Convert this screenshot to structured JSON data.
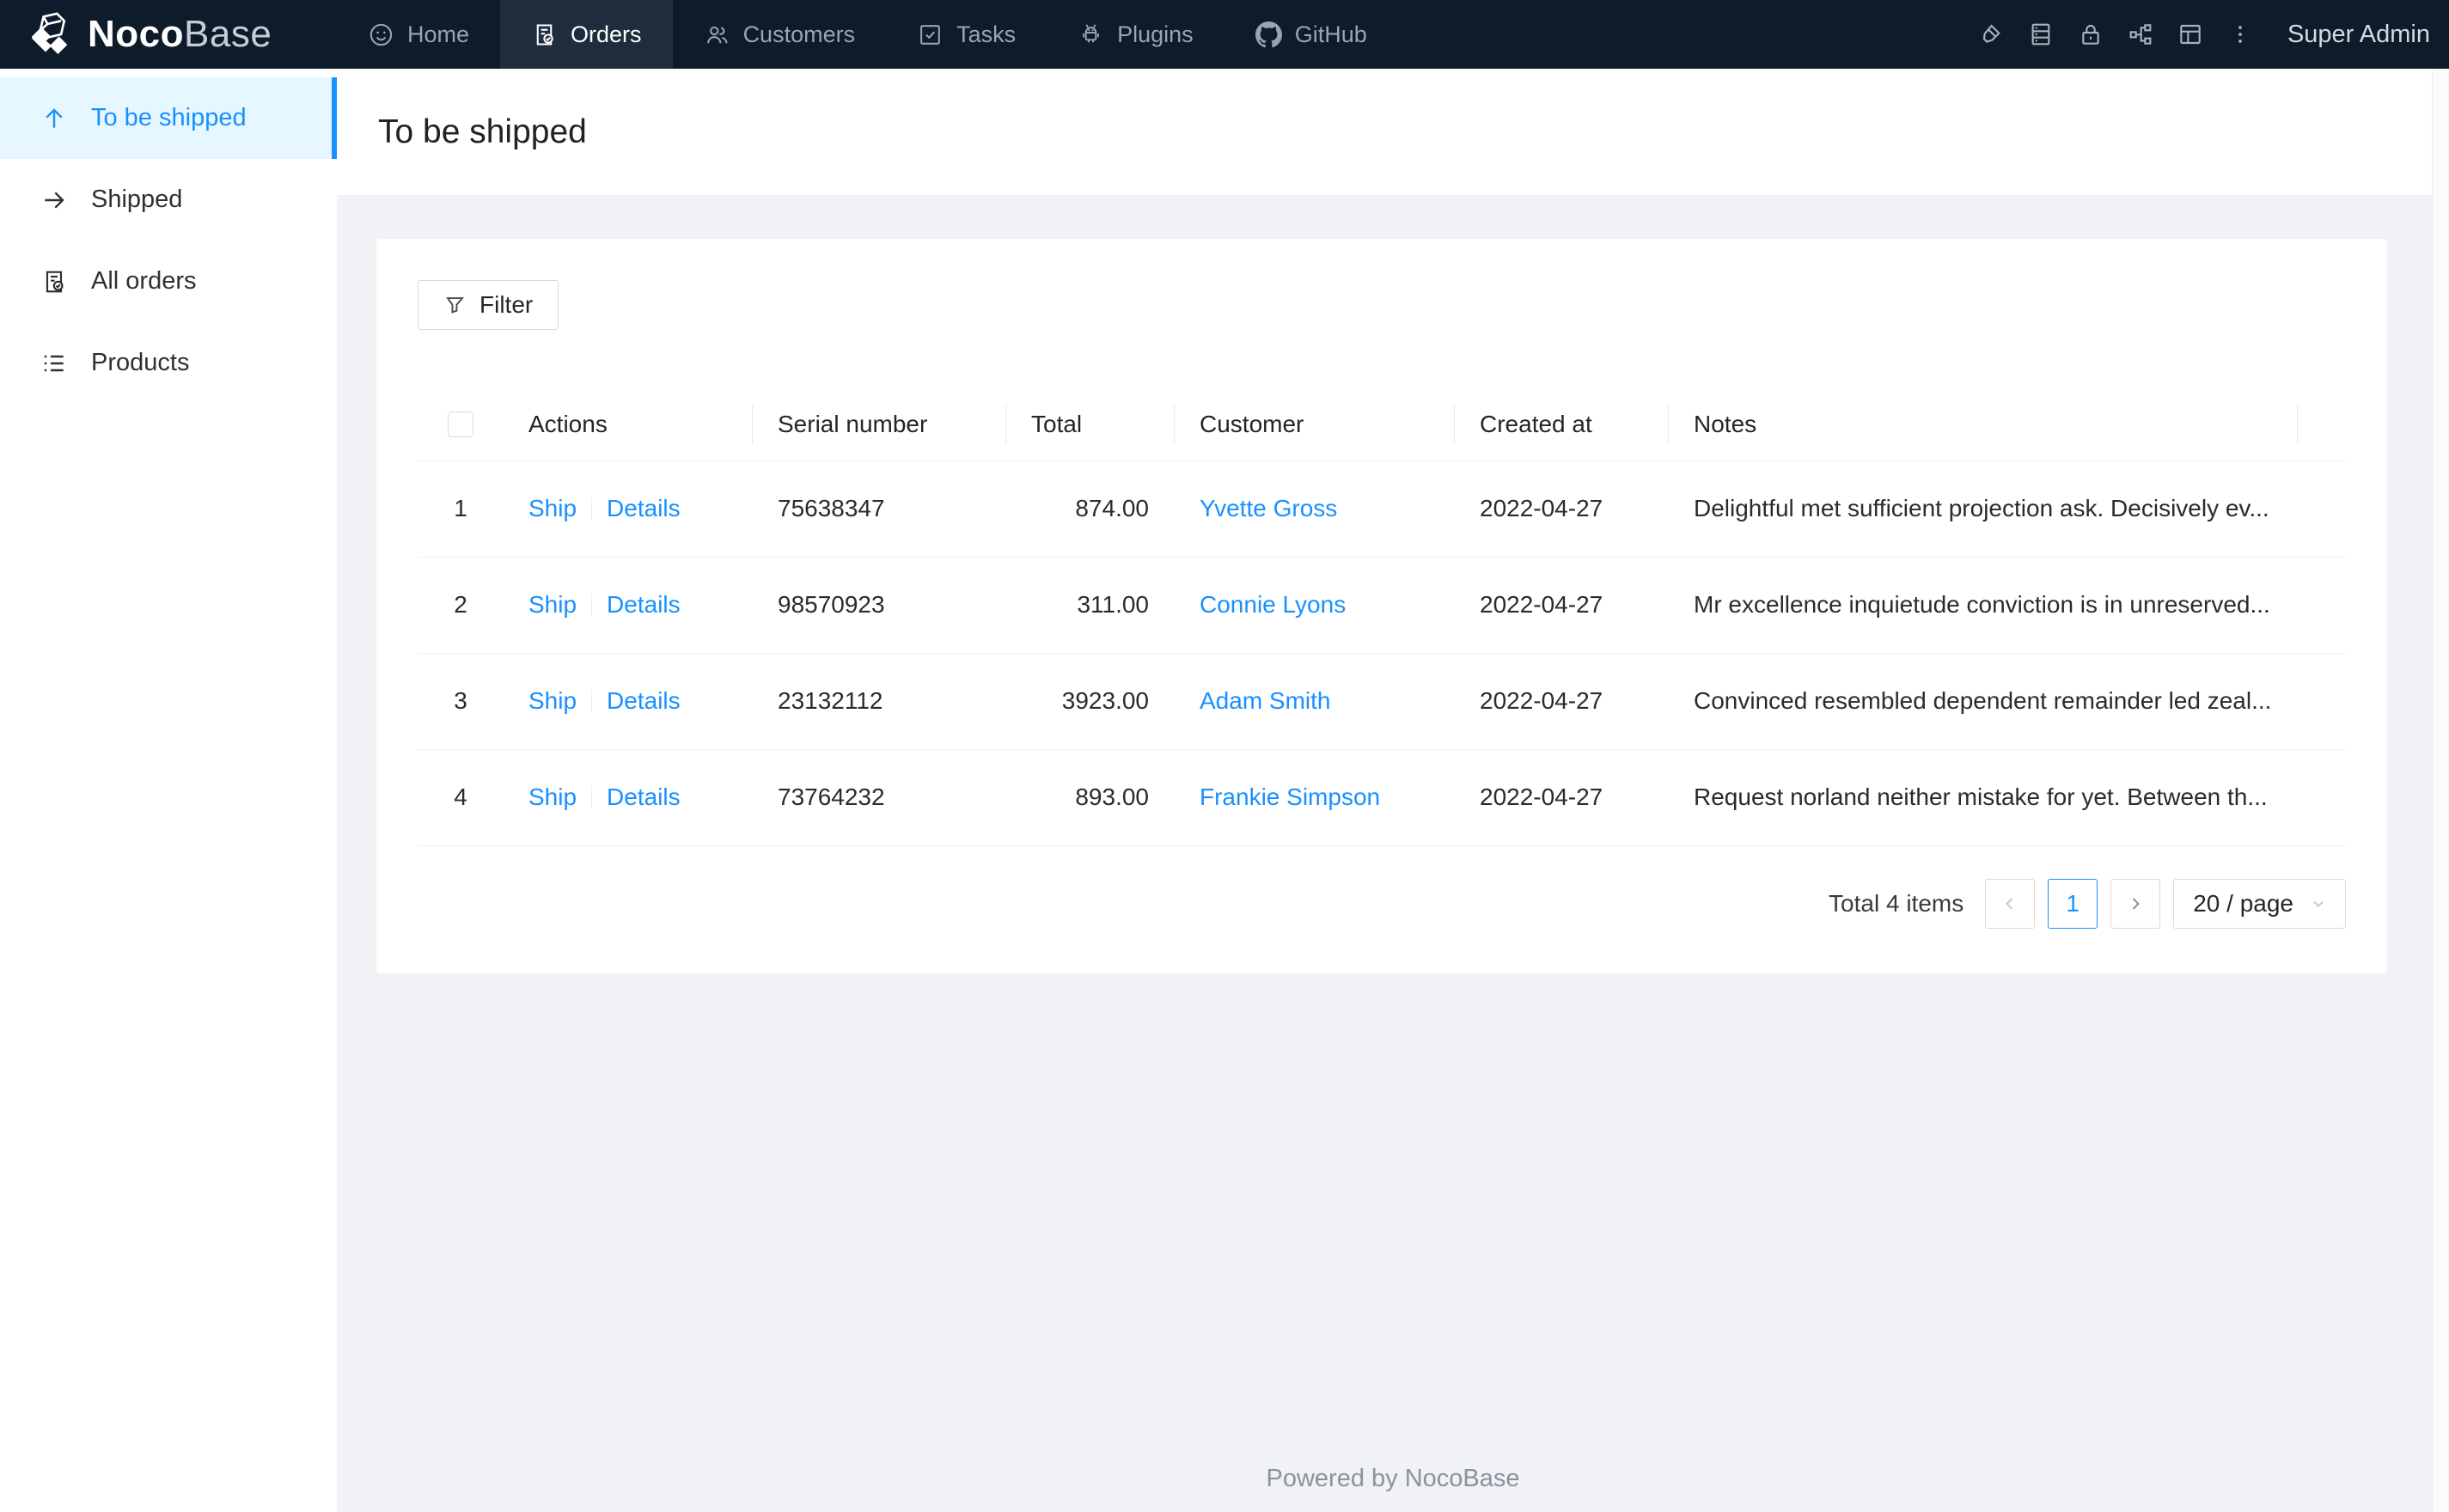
{
  "colors": {
    "accent": "#1890ff",
    "navbar_bg": "#0d1b2a",
    "navbar_active_bg": "#1e2c3e",
    "sidebar_active_bg": "#e6f7ff",
    "content_bg": "#f0f2f5"
  },
  "navbar": {
    "logo": {
      "text_bold": "Noco",
      "text_light": "Base",
      "icon": "nocobase-cube-logo"
    },
    "menu": [
      {
        "label": "Home",
        "icon": "smile-icon",
        "active": false
      },
      {
        "label": "Orders",
        "icon": "file-done-icon",
        "active": true
      },
      {
        "label": "Customers",
        "icon": "team-icon",
        "active": false
      },
      {
        "label": "Tasks",
        "icon": "check-square-icon",
        "active": false
      },
      {
        "label": "Plugins",
        "icon": "robot-icon",
        "active": false
      },
      {
        "label": "GitHub",
        "icon": "github-icon",
        "active": false
      }
    ],
    "right_icons": [
      "highlight-icon",
      "database-icon",
      "lock-icon",
      "apartment-icon",
      "layout-icon",
      "more-icon"
    ],
    "user": "Super Admin"
  },
  "sidebar": {
    "items": [
      {
        "label": "To be shipped",
        "icon": "arrow-up-icon",
        "active": true
      },
      {
        "label": "Shipped",
        "icon": "arrow-right-icon",
        "active": false
      },
      {
        "label": "All orders",
        "icon": "file-done-icon",
        "active": false
      },
      {
        "label": "Products",
        "icon": "list-icon",
        "active": false
      }
    ]
  },
  "page": {
    "title": "To be shipped"
  },
  "toolbar": {
    "filter_label": "Filter"
  },
  "table": {
    "columns": [
      "Actions",
      "Serial number",
      "Total",
      "Customer",
      "Created at",
      "Notes"
    ],
    "rows": [
      {
        "index": "1",
        "actions": [
          "Ship",
          "Details"
        ],
        "serial": "75638347",
        "total": "874.00",
        "customer": "Yvette Gross",
        "created_at": "2022-04-27",
        "notes": "Delightful met sufficient projection ask. Decisively ev..."
      },
      {
        "index": "2",
        "actions": [
          "Ship",
          "Details"
        ],
        "serial": "98570923",
        "total": "311.00",
        "customer": "Connie Lyons",
        "created_at": "2022-04-27",
        "notes": "Mr excellence inquietude conviction is in unreserved..."
      },
      {
        "index": "3",
        "actions": [
          "Ship",
          "Details"
        ],
        "serial": "23132112",
        "total": "3923.00",
        "customer": "Adam Smith",
        "created_at": "2022-04-27",
        "notes": "Convinced resembled dependent remainder led zeal..."
      },
      {
        "index": "4",
        "actions": [
          "Ship",
          "Details"
        ],
        "serial": "73764232",
        "total": "893.00",
        "customer": "Frankie Simpson",
        "created_at": "2022-04-27",
        "notes": "Request norland neither mistake for yet. Between th..."
      }
    ]
  },
  "pagination": {
    "total_text": "Total 4 items",
    "current_page": "1",
    "page_size": "20 / page"
  },
  "footer": {
    "text": "Powered by NocoBase"
  }
}
